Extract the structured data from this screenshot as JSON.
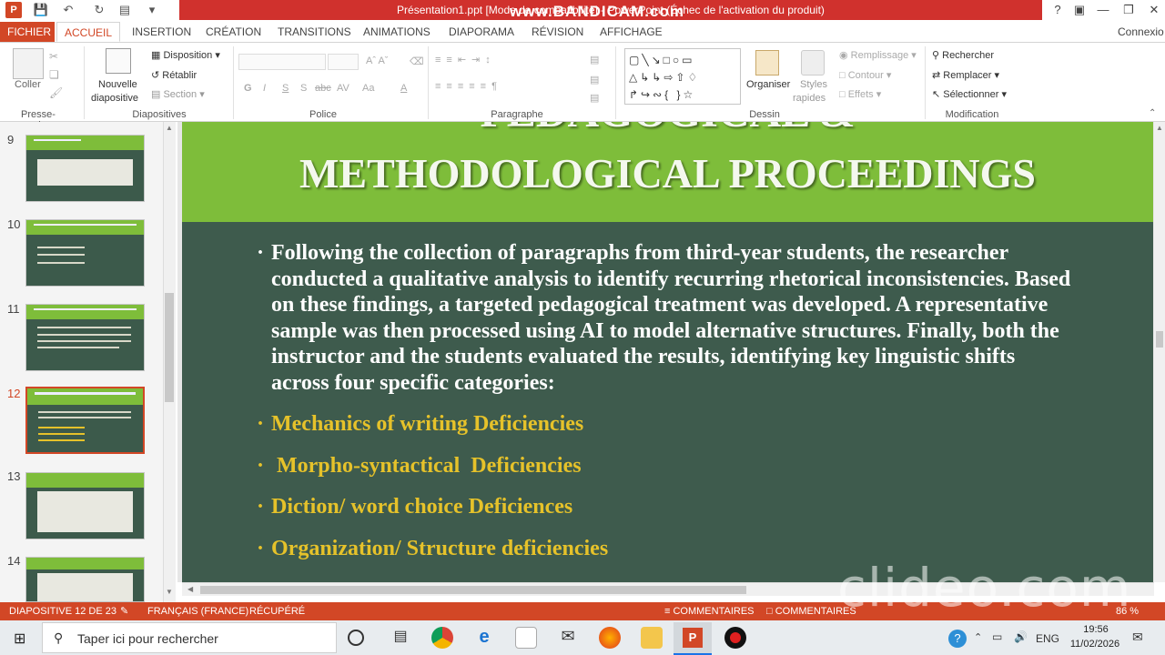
{
  "titlebar": {
    "title": "Présentation1.ppt [Mode de compatibilité] - PowerPoint (Échec de l'activation du produit)",
    "overlay": "www.BANDICAM.com",
    "help": "?",
    "qa_icons": [
      "powerpoint-logo",
      "save-icon",
      "undo-icon",
      "redo-icon",
      "start-slideshow-icon",
      "customize-icon"
    ],
    "window_controls": [
      "ribbon-display-icon",
      "minimize-icon",
      "restore-icon",
      "close-icon"
    ],
    "account": "Connexio"
  },
  "tabs": [
    "FICHIER",
    "ACCUEIL",
    "INSERTION",
    "CRÉATION",
    "TRANSITIONS",
    "ANIMATIONS",
    "DIAPORAMA",
    "RÉVISION",
    "AFFICHAGE"
  ],
  "ribbon": {
    "clipboard": {
      "paste": "Coller",
      "group": "Presse-papiers"
    },
    "slides": {
      "new_slide": "Nouvelle",
      "new_slide_2": "diapositive",
      "layout": "Disposition",
      "reset": "Rétablir",
      "section": "Section",
      "group": "Diapositives"
    },
    "font": {
      "group": "Police",
      "bold": "G",
      "italic": "I",
      "underline": "S",
      "shadow": "S",
      "strike": "abc",
      "spacing": "AV",
      "case": "Aa"
    },
    "paragraph": {
      "group": "Paragraphe"
    },
    "drawing": {
      "arrange": "Organiser",
      "quick_styles": "Styles",
      "quick_styles_2": "rapides",
      "fill": "Remplissage",
      "outline": "Contour",
      "effects": "Effets",
      "group": "Dessin"
    },
    "editing": {
      "find": "Rechercher",
      "replace": "Remplacer",
      "select": "Sélectionner",
      "group": "Modification"
    }
  },
  "thumbnails": [
    {
      "num": "9"
    },
    {
      "num": "10"
    },
    {
      "num": "11"
    },
    {
      "num": "12"
    },
    {
      "num": "13"
    },
    {
      "num": "14"
    }
  ],
  "slide": {
    "title_line1": "PEDAGOGICAL &",
    "title_line2": "METHODOLOGICAL PROCEEDINGS",
    "paragraph": "Following the collection of paragraphs from third-year students, the researcher conducted a qualitative analysis to identify recurring rhetorical inconsistencies. Based on these findings, a targeted pedagogical treatment was developed. A representative sample was then processed using AI to model alternative structures. Finally, both the instructor and the students evaluated the results, identifying key linguistic shifts across four specific categories:",
    "categories": [
      "Mechanics of writing Deficiencies",
      " Morpho-syntactical  Deficiencies",
      "Diction/ word choice Deficiences",
      "Organization/ Structure deficiencies"
    ]
  },
  "status": {
    "slide": "DIAPOSITIVE 12 DE 23",
    "language": "FRANÇAIS (FRANCE)",
    "recovered": "RÉCUPÉRÉ",
    "notes": "COMMENTAIRES",
    "comments": "COMMENTAIRES",
    "zoom": "86 %"
  },
  "taskbar": {
    "search_placeholder": "Taper ici pour rechercher",
    "language": "ENG",
    "time": "19:56",
    "date": "11/02/2026"
  },
  "watermark": "clideo.com",
  "colors": {
    "accent": "#d24726",
    "slide_green": "#7ebd3a",
    "slide_bg": "#3e5b4d",
    "category": "#e6c22a"
  }
}
